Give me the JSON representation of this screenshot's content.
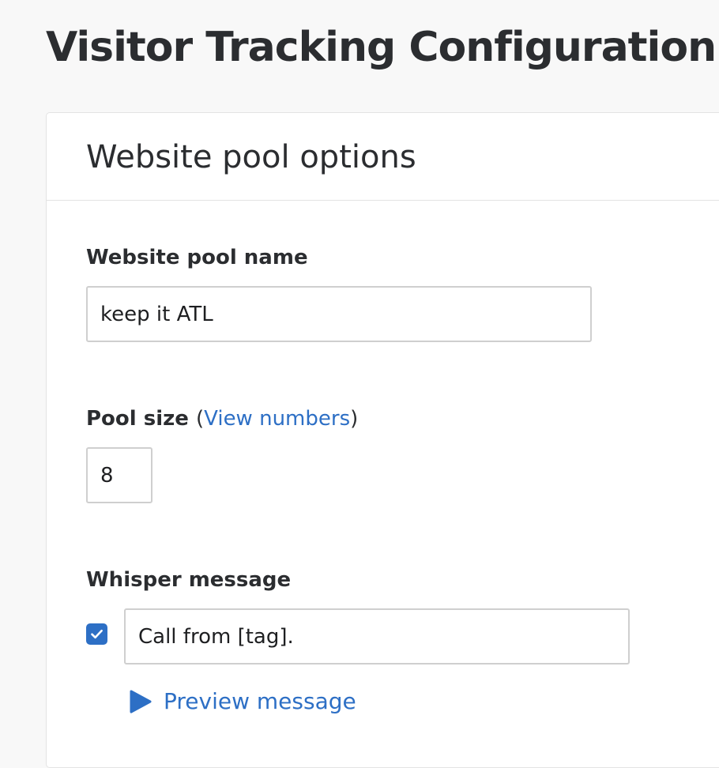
{
  "page": {
    "title": "Visitor Tracking Configuration"
  },
  "card": {
    "title": "Website pool options"
  },
  "fields": {
    "pool_name": {
      "label": "Website pool name",
      "value": "keep it ATL"
    },
    "pool_size": {
      "label": "Pool size",
      "paren_open": "(",
      "link_text": "View numbers",
      "paren_close": ")",
      "value": "8"
    },
    "whisper": {
      "label": "Whisper message",
      "enabled": true,
      "value": "Call from [tag].",
      "preview_label": "Preview message"
    }
  },
  "icons": {
    "checkbox_icon": "check-icon",
    "preview_icon": "play-icon"
  },
  "colors": {
    "accent": "#2d6fc5",
    "text": "#2b2d30",
    "border": "#cfcfcf",
    "page_bg": "#f8f8f8"
  }
}
